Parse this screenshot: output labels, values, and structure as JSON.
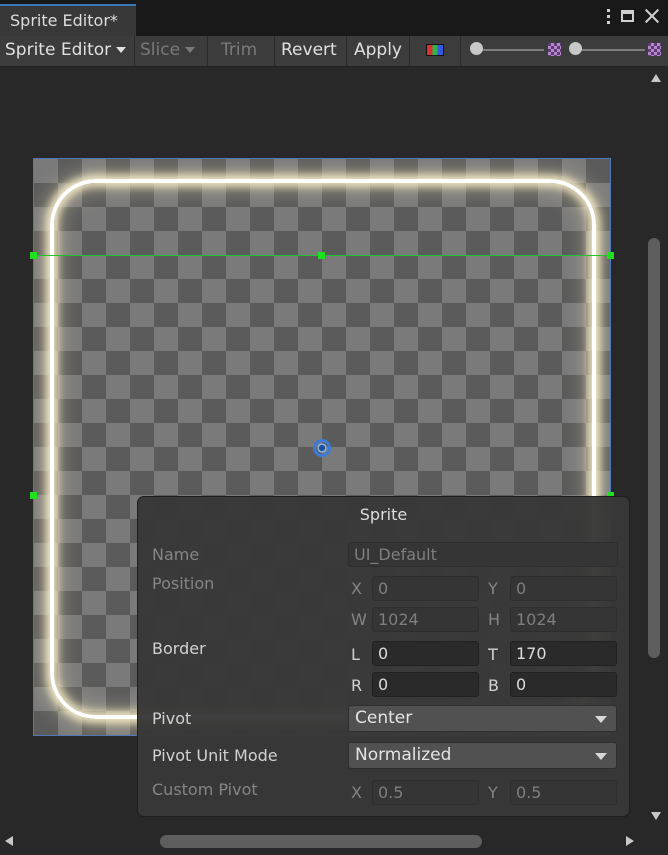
{
  "window": {
    "tab_title": "Sprite Editor*"
  },
  "toolbar": {
    "mode_label": "Sprite Editor",
    "slice_label": "Slice",
    "trim_label": "Trim",
    "revert_label": "Revert",
    "apply_label": "Apply",
    "icons": [
      "rgb-channel-icon",
      "alpha-checker-icon",
      "mip-checker-icon"
    ]
  },
  "sprite_panel": {
    "title": "Sprite",
    "name_label": "Name",
    "name_value": "UI_Default",
    "position_label": "Position",
    "position": {
      "x_label": "X",
      "x_value": "0",
      "y_label": "Y",
      "y_value": "0",
      "w_label": "W",
      "w_value": "1024",
      "h_label": "H",
      "h_value": "1024"
    },
    "border_label": "Border",
    "border": {
      "l_label": "L",
      "l_value": "0",
      "t_label": "T",
      "t_value": "170",
      "r_label": "R",
      "r_value": "0",
      "b_label": "B",
      "b_value": "0"
    },
    "pivot_label": "Pivot",
    "pivot_value": "Center",
    "pivot_unit_label": "Pivot Unit Mode",
    "pivot_unit_value": "Normalized",
    "custom_pivot_label": "Custom Pivot",
    "custom_pivot": {
      "x_label": "X",
      "x_value": "0.5",
      "y_label": "Y",
      "y_value": "0.5"
    }
  },
  "colors": {
    "accent": "#3a79bb",
    "border_line": "#22c22c",
    "pivot": "#3d7bd8"
  }
}
